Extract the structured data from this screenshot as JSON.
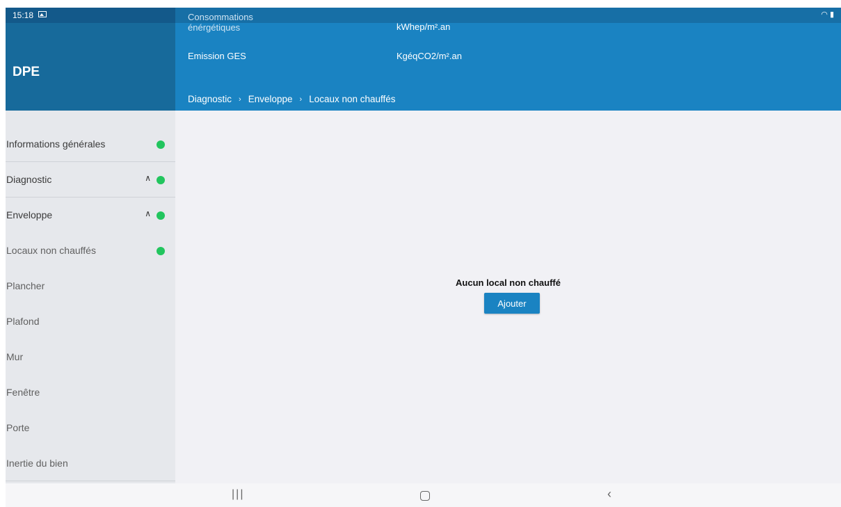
{
  "status_bar": {
    "time": "15:18",
    "left_icon": "gallery-icon",
    "right_icons": [
      "wifi-icon",
      "battery-icon"
    ]
  },
  "app": {
    "title": "DPE"
  },
  "header": {
    "consommation_label": "Consommations énérgétiques",
    "consommation_unit": "kWhep/m².an",
    "emission_label": "Emission GES",
    "emission_unit": "KgéqCO2/m².an",
    "breadcrumb": [
      "Diagnostic",
      "Enveloppe",
      "Locaux non chauffés"
    ]
  },
  "sidebar": {
    "items": [
      {
        "label": "Informations générales",
        "status": "complete"
      },
      {
        "label": "Diagnostic",
        "expanded": true,
        "status": "complete"
      },
      {
        "label": "Enveloppe",
        "expanded": true,
        "status": "complete"
      },
      {
        "label": "Locaux non chauffés",
        "status": "complete"
      },
      {
        "label": "Plancher"
      },
      {
        "label": "Plafond"
      },
      {
        "label": "Mur"
      },
      {
        "label": "Fenêtre"
      },
      {
        "label": "Porte"
      },
      {
        "label": "Inertie du bien"
      }
    ],
    "status_color": "#22c55e"
  },
  "main": {
    "empty_message": "Aucun local non chauffé",
    "add_button": "Ajouter"
  },
  "colors": {
    "primary": "#1a83c2",
    "primary_dark": "#176a9b",
    "sidebar_bg": "#e6e8ec",
    "content_bg": "#f1f1f5"
  },
  "nav_bar": {
    "buttons": [
      "recents-icon",
      "home-icon",
      "back-icon"
    ]
  }
}
